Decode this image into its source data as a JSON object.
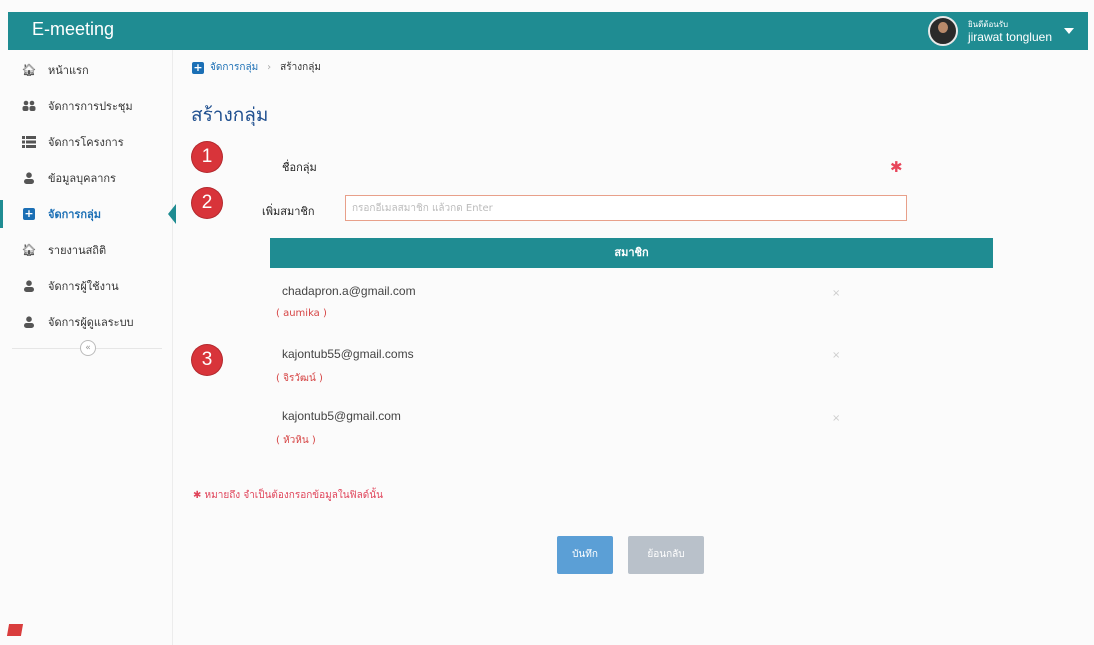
{
  "app": {
    "title": "E-meeting"
  },
  "user": {
    "welcome": "ยินดีต้อนรับ",
    "name": "jirawat tongluen"
  },
  "sidebar": {
    "items": [
      {
        "label": "หน้าแรก",
        "icon": "home-icon"
      },
      {
        "label": "จัดการการประชุม",
        "icon": "users-icon"
      },
      {
        "label": "จัดการโครงการ",
        "icon": "list-icon"
      },
      {
        "label": "ข้อมูลบุคลากร",
        "icon": "user-icon"
      },
      {
        "label": "จัดการกลุ่ม",
        "icon": "plus-square-icon",
        "active": true
      },
      {
        "label": "รายงานสถิติ",
        "icon": "home-icon"
      },
      {
        "label": "จัดการผู้ใช้งาน",
        "icon": "user-icon"
      },
      {
        "label": "จัดการผู้ดูแลระบบ",
        "icon": "user-icon"
      }
    ],
    "collapse_symbol": "«"
  },
  "breadcrumb": {
    "parent": "จัดการกลุ่ม",
    "separator": "›",
    "current": "สร้างกลุ่ม"
  },
  "page_title": "สร้างกลุ่ม",
  "badges": [
    "1",
    "2",
    "3"
  ],
  "form": {
    "group_name_label": "ชื่อกลุ่ม",
    "required_mark": "✱",
    "add_member_label": "เพิ่มสมาชิก",
    "add_member_placeholder": "กรอกอีเมลสมาชิก แล้วกด Enter"
  },
  "members": {
    "header": "สมาชิก",
    "rows": [
      {
        "email": "chadapron.a@gmail.com",
        "name": "( aumika )"
      },
      {
        "email": "kajontub55@gmail.coms",
        "name": "( จิรวัฒน์ )"
      },
      {
        "email": "kajontub5@gmail.com",
        "name": "( หัวหิน )"
      }
    ],
    "remove_symbol": "×"
  },
  "note": "✱ หมายถึง จำเป็นต้องกรอกข้อมูลในฟิลด์นั้น",
  "buttons": {
    "save": "บันทึก",
    "cancel": "ย้อนกลับ"
  },
  "colors": {
    "topbar": "#1f8c92",
    "link": "#1b6fb5",
    "badge": "#d8343a",
    "save": "#5b9fd6",
    "cancel": "#b9c1ca"
  }
}
